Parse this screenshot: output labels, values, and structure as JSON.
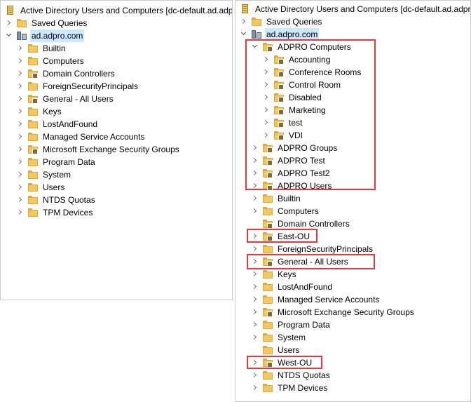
{
  "left": {
    "root": "Active Directory Users and Computers [dc-default.ad.adpr",
    "saved": "Saved Queries",
    "domain": "ad.adpro.com",
    "items": [
      "Builtin",
      "Computers",
      "Domain Controllers",
      "ForeignSecurityPrincipals",
      "General - All Users",
      "Keys",
      "LostAndFound",
      "Managed Service Accounts",
      "Microsoft Exchange Security Groups",
      "Program Data",
      "System",
      "Users",
      "NTDS Quotas",
      "TPM Devices"
    ]
  },
  "right": {
    "root": "Active Directory Users and Computers [dc-default.ad.adpro.c",
    "saved": "Saved Queries",
    "domain": "ad.adpro.com",
    "adpro_computers": "ADPRO Computers",
    "children": [
      "Accounting",
      "Conference Rooms",
      "Control Room",
      "Disabled",
      "Marketing",
      "test",
      "VDI"
    ],
    "items": [
      "ADPRO Groups",
      "ADPRO Test",
      "ADPRO Test2",
      "ADPRO Users",
      "Builtin",
      "Computers",
      "Domain Controllers",
      "East-OU",
      "ForeignSecurityPrincipals",
      "General - All Users",
      "Keys",
      "LostAndFound",
      "Managed Service Accounts",
      "Microsoft Exchange Security Groups",
      "Program Data",
      "System",
      "Users",
      "West-OU",
      "NTDS Quotas",
      "TPM Devices"
    ]
  },
  "colors": {
    "highlight": "#e0393e",
    "selection": "#cce8ff"
  }
}
